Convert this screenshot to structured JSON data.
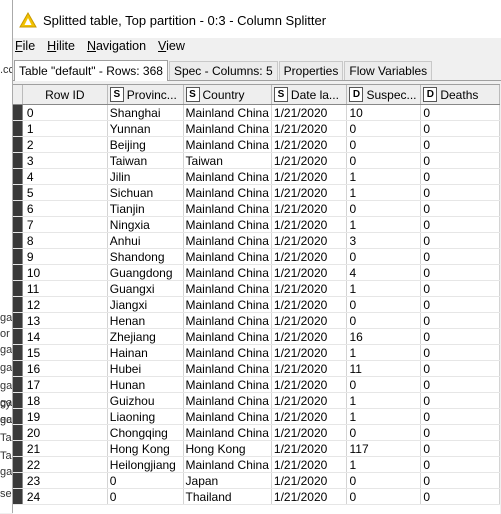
{
  "window": {
    "title": "Splitted table, Top partition - 0:3 - Column Splitter",
    "accent_color": "#f2c200"
  },
  "menu": {
    "items": [
      {
        "underline": "F",
        "rest": "ile"
      },
      {
        "underline": "H",
        "rest": "ilite"
      },
      {
        "underline": "N",
        "rest": "avigation"
      },
      {
        "underline": "V",
        "rest": "iew"
      }
    ]
  },
  "tabs": [
    {
      "label": "Table \"default\" - Rows: 368",
      "active": true
    },
    {
      "label": "Spec - Columns: 5",
      "active": false
    },
    {
      "label": "Properties",
      "active": false
    },
    {
      "label": "Flow Variables",
      "active": false
    }
  ],
  "background_text": [
    "ga",
    "or",
    "ga",
    "ga",
    "ga",
    "ga",
    "ga",
    "cy",
    "ect",
    "Ta",
    "Ta",
    "ga",
    "se",
    ".cc"
  ],
  "table": {
    "columns": [
      {
        "type": "",
        "label": "Row ID"
      },
      {
        "type": "S",
        "label": "Provinc..."
      },
      {
        "type": "S",
        "label": "Country"
      },
      {
        "type": "S",
        "label": "Date la..."
      },
      {
        "type": "D",
        "label": "Suspec..."
      },
      {
        "type": "D",
        "label": "Deaths"
      }
    ],
    "rows": [
      [
        "0",
        "Shanghai",
        "Mainland China",
        "1/21/2020",
        "10",
        "0"
      ],
      [
        "1",
        "Yunnan",
        "Mainland China",
        "1/21/2020",
        "0",
        "0"
      ],
      [
        "2",
        "Beijing",
        "Mainland China",
        "1/21/2020",
        "0",
        "0"
      ],
      [
        "3",
        "Taiwan",
        "Taiwan",
        "1/21/2020",
        "0",
        "0"
      ],
      [
        "4",
        "Jilin",
        "Mainland China",
        "1/21/2020",
        "1",
        "0"
      ],
      [
        "5",
        "Sichuan",
        "Mainland China",
        "1/21/2020",
        "1",
        "0"
      ],
      [
        "6",
        "Tianjin",
        "Mainland China",
        "1/21/2020",
        "0",
        "0"
      ],
      [
        "7",
        "Ningxia",
        "Mainland China",
        "1/21/2020",
        "1",
        "0"
      ],
      [
        "8",
        "Anhui",
        "Mainland China",
        "1/21/2020",
        "3",
        "0"
      ],
      [
        "9",
        "Shandong",
        "Mainland China",
        "1/21/2020",
        "0",
        "0"
      ],
      [
        "10",
        "Guangdong",
        "Mainland China",
        "1/21/2020",
        "4",
        "0"
      ],
      [
        "11",
        "Guangxi",
        "Mainland China",
        "1/21/2020",
        "1",
        "0"
      ],
      [
        "12",
        "Jiangxi",
        "Mainland China",
        "1/21/2020",
        "0",
        "0"
      ],
      [
        "13",
        "Henan",
        "Mainland China",
        "1/21/2020",
        "0",
        "0"
      ],
      [
        "14",
        "Zhejiang",
        "Mainland China",
        "1/21/2020",
        "16",
        "0"
      ],
      [
        "15",
        "Hainan",
        "Mainland China",
        "1/21/2020",
        "1",
        "0"
      ],
      [
        "16",
        "Hubei",
        "Mainland China",
        "1/21/2020",
        "11",
        "0"
      ],
      [
        "17",
        "Hunan",
        "Mainland China",
        "1/21/2020",
        "0",
        "0"
      ],
      [
        "18",
        "Guizhou",
        "Mainland China",
        "1/21/2020",
        "1",
        "0"
      ],
      [
        "19",
        "Liaoning",
        "Mainland China",
        "1/21/2020",
        "1",
        "0"
      ],
      [
        "20",
        "Chongqing",
        "Mainland China",
        "1/21/2020",
        "0",
        "0"
      ],
      [
        "21",
        "Hong Kong",
        "Hong Kong",
        "1/21/2020",
        "117",
        "0"
      ],
      [
        "22",
        "Heilongjiang",
        "Mainland China",
        "1/21/2020",
        "1",
        "0"
      ],
      [
        "23",
        "0",
        "Japan",
        "1/21/2020",
        "0",
        "0"
      ],
      [
        "24",
        "0",
        "Thailand",
        "1/21/2020",
        "0",
        "0"
      ]
    ]
  }
}
